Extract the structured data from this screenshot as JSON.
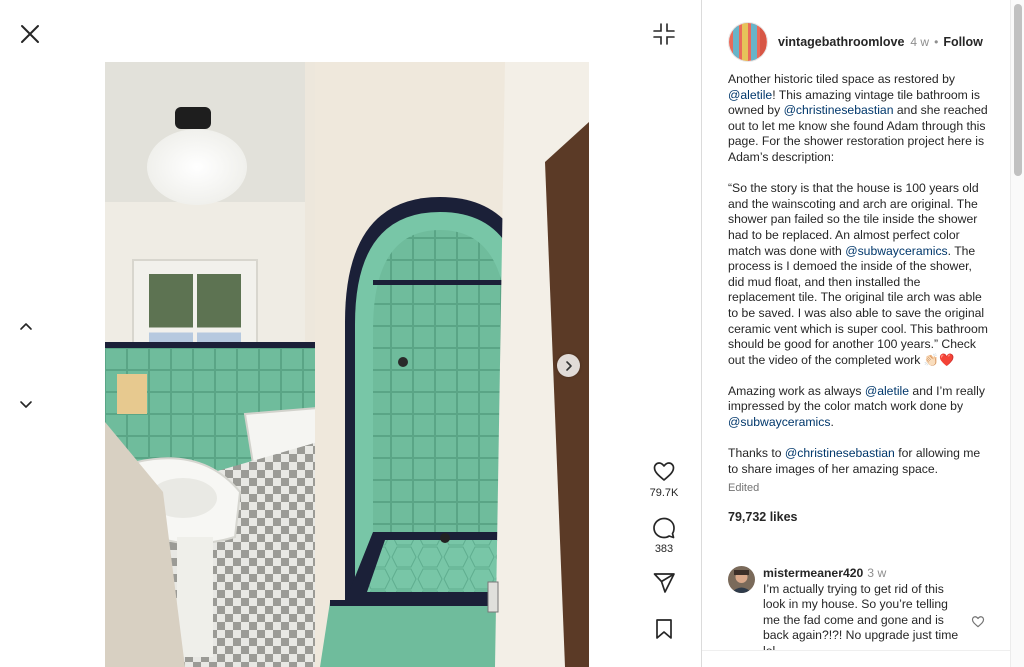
{
  "post": {
    "author": "vintagebathroomlove",
    "time_ago": "4 w",
    "follow_label": "Follow",
    "separator": "•",
    "caption": {
      "p1": {
        "t1": "Another historic tiled space as restored by ",
        "m1": "@aletile",
        "t2": "! This amazing vintage tile bathroom is owned by ",
        "m2": "@christinesebastian",
        "t3": " and she reached out to let me know she found Adam through this page. For the shower restoration project here is Adam’s description:"
      },
      "p2": {
        "t1": "“So the story is that the house is 100 years old and the wainscoting and arch are original. The shower pan failed so the tile inside the shower had to be replaced. An almost perfect color match was done with ",
        "m1": "@subwayceramics",
        "t2": ". The process is I demoed the inside of the shower, did mud float, and then installed the replacement tile. The original tile arch was able to be saved. I was also able to save the original ceramic vent which is super cool. This bathroom should be good for another 100 years.” Check out the video of the completed work 👏🏻❤️"
      },
      "p3": {
        "t1": "Amazing work as always ",
        "m1": "@aletile",
        "t2": " and I’m really impressed by the color match work done by ",
        "m2": "@subwayceramics",
        "t3": "."
      },
      "p4": {
        "t1": "Thanks to ",
        "m1": "@christinesebastian",
        "t2": " for allowing me to share images of her amazing space."
      }
    },
    "edited_label": "Edited",
    "likes_label": "79,732 likes"
  },
  "actions": {
    "like_count": "79.7K",
    "comment_count": "383"
  },
  "comment": {
    "user": "mistermeaner420",
    "time_ago": "3 w",
    "text": "I’m actually trying to get rid of this look in my house. So you’re telling me the fad come and gone and is back again?!?! No upgrade just time lol"
  },
  "icons": {
    "close": "close-icon",
    "collapse": "collapse-icon",
    "prev": "chevron-up-icon",
    "next": "chevron-down-icon",
    "carousel_next": "chevron-right-icon",
    "like": "heart-icon",
    "comment": "comment-icon",
    "share": "send-icon",
    "save": "bookmark-icon"
  },
  "colors": {
    "text": "#262626",
    "mention": "#00376b",
    "muted": "#8e8e8e",
    "tile_green": "#7cc4a6"
  }
}
